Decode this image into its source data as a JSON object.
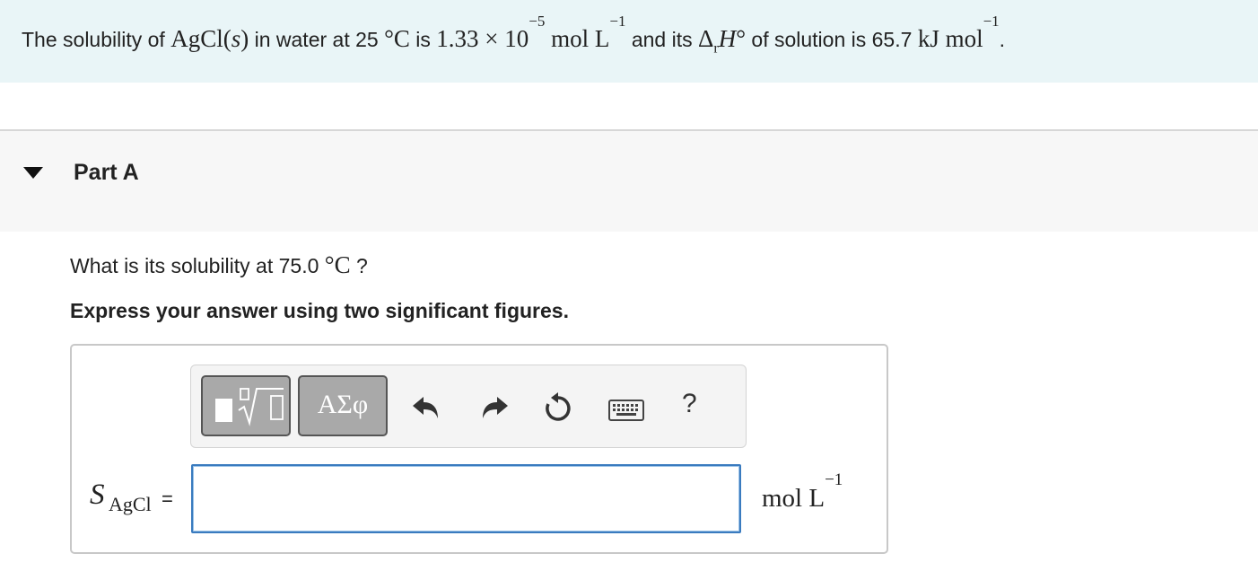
{
  "intro": {
    "t1": "The solubility of ",
    "m_agcl": "AgCl(",
    "m_s": "s",
    "m_close": ")",
    "t2": " in water at 25 ",
    "m_degC": "°C",
    "t3": " is ",
    "m_val": "1.33 × 10",
    "m_exp1": "−5",
    "m_units1": " mol L",
    "m_exp2": "−1",
    "t4": " and its ",
    "m_delta": "Δ",
    "m_r": "r",
    "m_H": "H",
    "m_deg": "°",
    "t5": " of solution is 65.7 ",
    "m_units2": "kJ mol",
    "m_exp3": "−1",
    "t6": "."
  },
  "part": {
    "title": "Part A"
  },
  "question": {
    "text": "What is its solubility at 75.0 ",
    "unit": "°C",
    "suffix": " ?"
  },
  "instruction": "Express your answer using two significant figures.",
  "toolbar": {
    "symbols_label": "ΑΣφ",
    "help_label": "?",
    "icons": [
      "templates-icon",
      "undo-icon",
      "redo-icon",
      "reset-icon",
      "keyboard-icon",
      "help-icon"
    ]
  },
  "answer": {
    "label_var": "S",
    "label_sub": "AgCl",
    "equals": "=",
    "value": "",
    "units": "mol L",
    "units_exp": "−1"
  },
  "colors": {
    "intro_bg": "#e9f5f7",
    "part_band_bg": "#f7f7f7",
    "input_border": "#3a7bbf",
    "button_bg": "#a9a9a9"
  }
}
